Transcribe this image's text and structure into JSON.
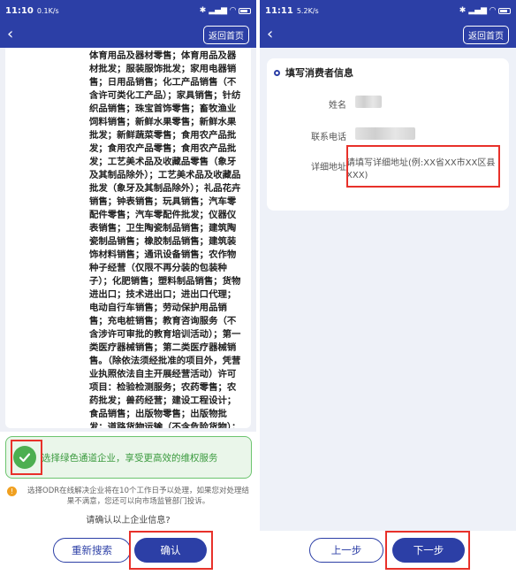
{
  "left_screen": {
    "status": {
      "time": "11:10",
      "speed": "0.1K/s"
    },
    "nav": {
      "home_label": "返回首页"
    },
    "scope_text": "体育用品及器材零售；体育用品及器材批发；服装服饰批发；家用电器销售；日用品销售；化工产品销售（不含许可类化工产品）；家具销售；针纺织品销售；珠宝首饰零售；畜牧渔业饲料销售；新鲜水果零售；新鲜水果批发；新鲜蔬菜零售；食用农产品批发；食用农产品零售；食用农产品批发；工艺美术品及收藏品零售（象牙及其制品除外）；工艺美术品及收藏品批发（象牙及其制品除外）；礼品花卉销售；钟表销售；玩具销售；汽车零配件零售；汽车零配件批发；仪器仪表销售；卫生陶瓷制品销售；建筑陶瓷制品销售；橡胶制品销售；建筑装饰材料销售；通讯设备销售；农作物种子经营（仅限不再分装的包装种子）；化肥销售；塑料制品销售；货物进出口；技术进出口；进出口代理；电动自行车销售；劳动保护用品销售；充电桩销售；教育咨询服务（不含涉许可审批的教育培训活动）；第一类医疗器械销售；第二类医疗器械销售。（除依法须经批准的项目外，凭营业执照依法自主开展经营活动）许可项目：检验检测服务；农药零售；农药批发；兽药经营；建设工程设计；食品销售；出版物零售；出版物批发；道路货物运输（不含危险货物）；第三类医疗器械经营。（依法须经批准的项目，经相关部门批准后方可开展经营活动，具体经营项目以相关部门批准文件或许可证件为准）（不得从事国家和本市产业政策禁止和限制类项目的经营活动。）",
    "green_option": "选择绿色通道企业，享受更高效的维权服务",
    "notice": "选择ODR在线解决企业将在10个工作日予以处理，如果您对处理结果不满意，您还可以向市场监管部门投诉。",
    "confirm_question": "请确认以上企业信息?",
    "buttons": {
      "research": "重新搜索",
      "confirm": "确认"
    }
  },
  "right_screen": {
    "status": {
      "time": "11:11",
      "speed": "5.2K/s"
    },
    "nav": {
      "home_label": "返回首页"
    },
    "form": {
      "title": "填写消费者信息",
      "name_label": "姓名",
      "phone_label": "联系电话",
      "address_label": "详细地址",
      "address_placeholder": "请填写详细地址(例:XX省XX市XX区县XXX)"
    },
    "buttons": {
      "prev": "上一步",
      "next": "下一步"
    }
  },
  "colors": {
    "primary": "#2c3fa6",
    "green": "#4caf50",
    "highlight": "#e8312a"
  }
}
